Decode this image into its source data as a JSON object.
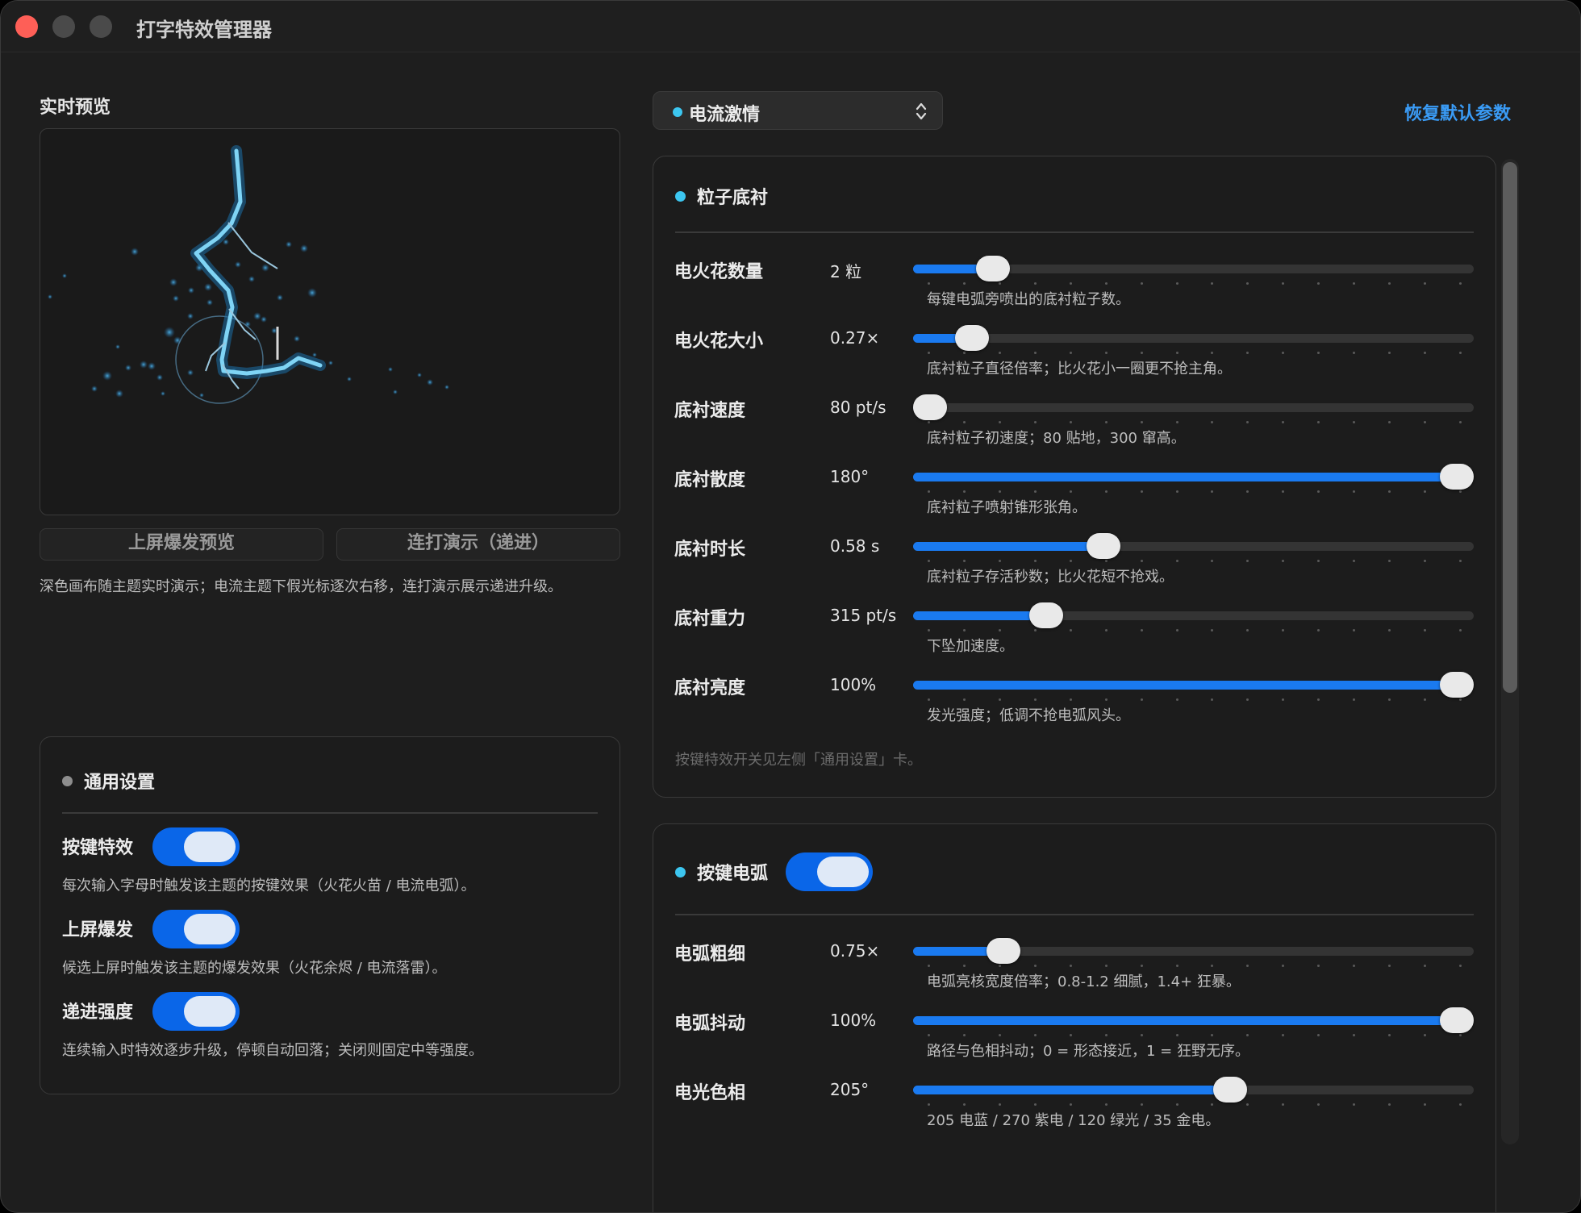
{
  "window": {
    "title": "打字特效管理器"
  },
  "preview": {
    "label": "实时预览",
    "burst_button": "上屏爆发预览",
    "combo_button": "连打演示（递进）",
    "caption": "深色画布随主题实时演示；电流主题下假光标逐次右移，连打演示展示递进升级。"
  },
  "general": {
    "title": "通用设置",
    "dot_color": "#8e8e8e",
    "rows": [
      {
        "label": "按键特效",
        "on": true,
        "desc": "每次输入字母时触发该主题的按键效果（火花火苗 / 电流电弧）。"
      },
      {
        "label": "上屏爆发",
        "on": true,
        "desc": "候选上屏时触发该主题的爆发效果（火花余烬 / 电流落雷）。"
      },
      {
        "label": "递进强度",
        "on": true,
        "desc": "连续输入时特效逐步升级，停顿自动回落；关闭则固定中等强度。"
      }
    ]
  },
  "theme_select": {
    "value": "电流激情",
    "dot_color": "#3cc6f0"
  },
  "reset_link": "恢复默认参数",
  "particles": {
    "title": "粒子底衬",
    "dot_color": "#3cc6f0",
    "sliders": [
      {
        "label": "电火花数量",
        "value": "2 粒",
        "fraction": 0.12,
        "desc": "每键电弧旁喷出的底衬粒子数。"
      },
      {
        "label": "电火花大小",
        "value": "0.27×",
        "fraction": 0.08,
        "desc": "底衬粒子直径倍率；比火花小一圈更不抢主角。"
      },
      {
        "label": "底衬速度",
        "value": "80 pt/s",
        "fraction": 0.0,
        "desc": "底衬粒子初速度；80 贴地，300 窜高。"
      },
      {
        "label": "底衬散度",
        "value": "180°",
        "fraction": 1.0,
        "desc": "底衬粒子喷射锥形张角。"
      },
      {
        "label": "底衬时长",
        "value": "0.58 s",
        "fraction": 0.33,
        "desc": "底衬粒子存活秒数；比火花短不抢戏。"
      },
      {
        "label": "底衬重力",
        "value": "315 pt/s",
        "fraction": 0.22,
        "desc": "下坠加速度。"
      },
      {
        "label": "底衬亮度",
        "value": "100%",
        "fraction": 1.0,
        "desc": "发光强度；低调不抢电弧风头。"
      }
    ],
    "footnote": "按键特效开关见左侧「通用设置」卡。"
  },
  "arc": {
    "title": "按键电弧",
    "dot_color": "#3cc6f0",
    "enabled": true,
    "sliders": [
      {
        "label": "电弧粗细",
        "value": "0.75×",
        "fraction": 0.14,
        "desc": "电弧亮核宽度倍率；0.8-1.2 细腻，1.4+ 狂暴。"
      },
      {
        "label": "电弧抖动",
        "value": "100%",
        "fraction": 1.0,
        "desc": "路径与色相抖动；0 = 形态接近，1 = 狂野无序。"
      },
      {
        "label": "电光色相",
        "value": "205°",
        "fraction": 0.57,
        "desc": "205 电蓝 / 270 紫电 / 120 绿光 / 35 金电。"
      }
    ]
  },
  "colors": {
    "accent": "#1a7af0",
    "link": "#3a9bf5",
    "close": "#fe5f57"
  }
}
